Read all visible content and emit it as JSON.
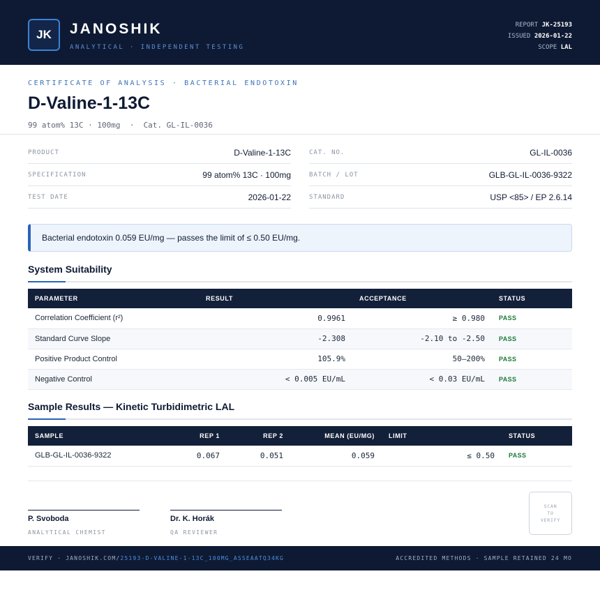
{
  "brand": {
    "logo_text": "JK",
    "name": "JANOSHIK",
    "tagline": "ANALYTICAL · INDEPENDENT TESTING"
  },
  "report": {
    "report_label": "REPORT",
    "report_value": "JK-25193",
    "issued_label": "ISSUED",
    "issued_value": "2026-01-22",
    "scope_label": "SCOPE",
    "scope_value": "LAL"
  },
  "title_section": {
    "certificate_type": "CERTIFICATE OF ANALYSIS · BACTERIAL ENDOTOXIN",
    "product_title": "D-Valine-1-13C",
    "subtitle": "99 atom% 13C · 100mg  ·  Cat. GL-IL-0036"
  },
  "info": {
    "left": [
      {
        "label": "PRODUCT",
        "value": "D-Valine-1-13C"
      },
      {
        "label": "SPECIFICATION",
        "value": "99 atom% 13C · 100mg"
      },
      {
        "label": "TEST DATE",
        "value": "2026-01-22"
      }
    ],
    "right": [
      {
        "label": "CAT. NO.",
        "value": "GL-IL-0036"
      },
      {
        "label": "BATCH / LOT",
        "value": "GLB-GL-IL-0036-9322"
      },
      {
        "label": "STANDARD",
        "value": "USP <85> / EP 2.6.14"
      }
    ]
  },
  "callout": "Bacterial endotoxin 0.059 EU/mg — passes the limit of ≤ 0.50 EU/mg.",
  "system_suitability": {
    "title": "System Suitability",
    "headers": [
      "PARAMETER",
      "RESULT",
      "ACCEPTANCE",
      "STATUS"
    ],
    "rows": [
      {
        "parameter": "Correlation Coefficient (r²)",
        "result": "0.9961",
        "acceptance": "≥ 0.980",
        "status": "PASS"
      },
      {
        "parameter": "Standard Curve Slope",
        "result": "-2.308",
        "acceptance": "-2.10 to -2.50",
        "status": "PASS"
      },
      {
        "parameter": "Positive Product Control",
        "result": "105.9%",
        "acceptance": "50–200%",
        "status": "PASS"
      },
      {
        "parameter": "Negative Control",
        "result": "< 0.005 EU/mL",
        "acceptance": "< 0.03 EU/mL",
        "status": "PASS"
      }
    ]
  },
  "sample_results": {
    "title": "Sample Results — Kinetic Turbidimetric LAL",
    "headers": [
      "SAMPLE",
      "REP 1",
      "REP 2",
      "MEAN (EU/MG)",
      "LIMIT",
      "STATUS"
    ],
    "rows": [
      {
        "sample": "GLB-GL-IL-0036-9322",
        "rep1": "0.067",
        "rep2": "0.051",
        "mean": "0.059",
        "limit": "≤ 0.50",
        "status": "PASS"
      }
    ]
  },
  "signatures": [
    {
      "name": "P. Svoboda",
      "role": "ANALYTICAL CHEMIST"
    },
    {
      "name": "Dr. K. Horák",
      "role": "QA REVIEWER"
    }
  ],
  "qr": {
    "line1": "SCAN",
    "line2": "TO",
    "line3": "VERIFY"
  },
  "footer": {
    "verify_prefix": "VERIFY · JANOSHIK.COM/",
    "verify_link": "25193-D-VALINE-1-13C_100MG_ASSEAATQ34KG",
    "right_text": "ACCREDITED METHODS · SAMPLE RETAINED 24 MO"
  },
  "colors": {
    "navy": "#0e1a33",
    "accent_blue": "#2a63b8",
    "pass_green": "#1e7a3a"
  }
}
